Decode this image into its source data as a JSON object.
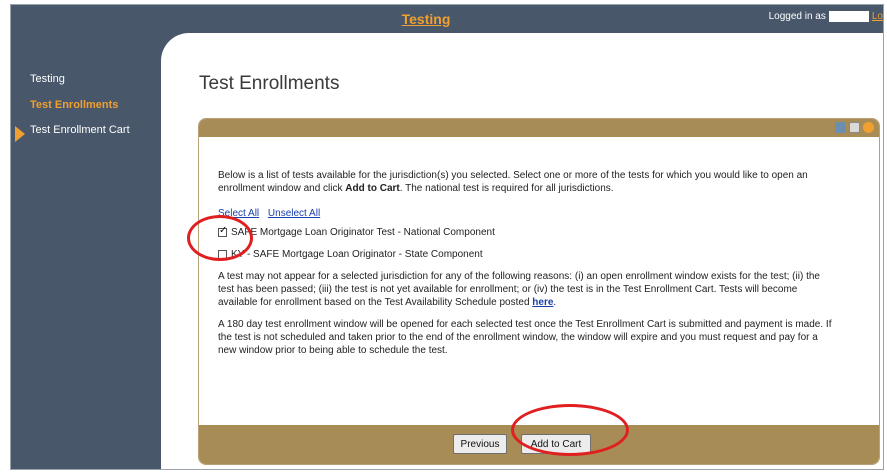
{
  "header": {
    "title": "Testing",
    "logged_in_label": "Logged in as",
    "logout_label": "Lo"
  },
  "sidebar": {
    "items": [
      {
        "label": "Testing"
      },
      {
        "label": "Test Enrollments"
      },
      {
        "label": "Test Enrollment Cart"
      }
    ]
  },
  "main": {
    "title": "Test Enrollments",
    "intro_text": "Below is a list of tests available for the jurisdiction(s) you selected. Select one or more of the tests for which you would like to open an enrollment window and click",
    "intro_bold": "Add to Cart",
    "intro_end": ". The national test is required for all jurisdictions.",
    "select_all": "Select All",
    "unselect_all": "Unselect All",
    "tests": [
      {
        "label": "SAFE Mortgage Loan Originator Test - National Component",
        "checked": true
      },
      {
        "label": "KY - SAFE Mortgage Loan Originator - State Component",
        "checked": false
      }
    ],
    "note1": "A test may not appear for a selected jurisdiction for any of the following reasons: (i) an open enrollment window exists for the test; (ii) the test has been passed; (iii) the test is not yet available for enrollment; or (iv) the test is in the Test Enrollment Cart. Tests will become available for enrollment based on the Test Availability Schedule posted",
    "note1_link": "here",
    "note1_end": ".",
    "note2": "A 180 day test enrollment window will be opened for each selected test once the Test Enrollment Cart is submitted and payment is made. If the test is not scheduled and taken prior to the end of the enrollment window, the window will expire and you must request and pay for a new window prior to being able to schedule the test.",
    "previous_button": "Previous",
    "add_button": "Add to Cart"
  },
  "colors": {
    "header_bg": "#48576a",
    "accent_orange": "#f0a030",
    "panel_tan": "#a88c55",
    "annotation_red": "#e02020"
  },
  "icons": [
    "print-icon",
    "page-icon",
    "help-icon"
  ]
}
